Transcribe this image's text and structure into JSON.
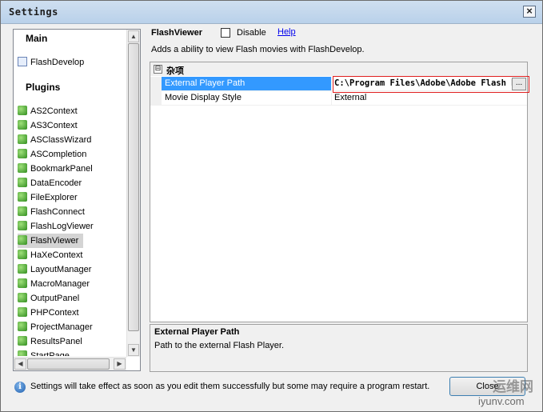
{
  "window": {
    "title": "Settings",
    "close_glyph": "×"
  },
  "sidebar": {
    "main_header": "Main",
    "main_items": [
      {
        "label": "FlashDevelop",
        "icon": "application-icon"
      }
    ],
    "plugins_header": "Plugins",
    "plugin_items": [
      "AS2Context",
      "AS3Context",
      "ASClassWizard",
      "ASCompletion",
      "BookmarkPanel",
      "DataEncoder",
      "FileExplorer",
      "FlashConnect",
      "FlashLogViewer",
      "FlashViewer",
      "HaXeContext",
      "LayoutManager",
      "MacroManager",
      "OutputPanel",
      "PHPContext",
      "ProjectManager",
      "ResultsPanel",
      "StartPage"
    ],
    "selected_item": "FlashViewer"
  },
  "plugin": {
    "title": "FlashViewer",
    "disable_label": "Disable",
    "disable_checked": false,
    "help_label": "Help",
    "description": "Adds a ability to view Flash movies with FlashDevelop."
  },
  "property_grid": {
    "category": "杂项",
    "collapse_glyph": "⊟",
    "rows": [
      {
        "name": "External Player Path",
        "value": "C:\\Program Files\\Adobe\\Adobe Flash Bu",
        "selected": true
      },
      {
        "name": "Movie Display Style",
        "value": "External",
        "selected": false
      }
    ],
    "ellipsis_label": "..."
  },
  "help_panel": {
    "title": "External Player Path",
    "description": "Path to the external Flash Player."
  },
  "footer": {
    "info_text": "Settings will take effect as soon as you edit them successfully but some may require a program restart.",
    "close_label": "Close"
  },
  "watermark": {
    "text": "运维网",
    "url": "iyunv.com"
  },
  "colors": {
    "selection": "#3399ff",
    "link": "#0000ee",
    "highlight_box": "#e02020"
  }
}
